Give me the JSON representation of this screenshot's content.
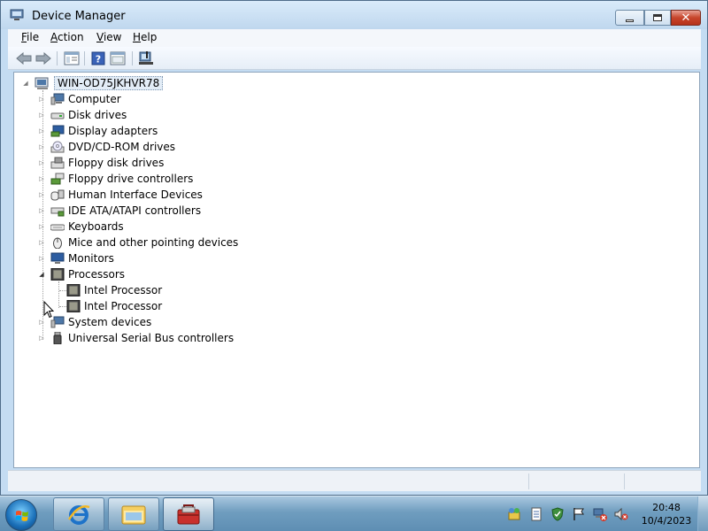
{
  "window": {
    "title": "Device Manager",
    "title_icon": "device-manager-icon"
  },
  "menu": {
    "items": [
      {
        "label": "File",
        "underline": "F",
        "rest": "ile"
      },
      {
        "label": "Action",
        "underline": "A",
        "rest": "ction"
      },
      {
        "label": "View",
        "underline": "V",
        "rest": "iew"
      },
      {
        "label": "Help",
        "underline": "H",
        "rest": "elp"
      }
    ]
  },
  "toolbar": {
    "buttons": [
      "back-arrow-icon",
      "forward-arrow-icon",
      "show-hide-console-tree-icon",
      "help-icon",
      "properties-icon",
      "scan-hardware-icon"
    ]
  },
  "tree": {
    "root": "WIN-OD75JKHVR78",
    "categories": [
      {
        "label": "Computer",
        "icon": "computer-icon",
        "expanded": false
      },
      {
        "label": "Disk drives",
        "icon": "disk-drive-icon",
        "expanded": false
      },
      {
        "label": "Display adapters",
        "icon": "display-adapter-icon",
        "expanded": false
      },
      {
        "label": "DVD/CD-ROM drives",
        "icon": "dvd-drive-icon",
        "expanded": false
      },
      {
        "label": "Floppy disk drives",
        "icon": "floppy-disk-icon",
        "expanded": false
      },
      {
        "label": "Floppy drive controllers",
        "icon": "floppy-controller-icon",
        "expanded": false
      },
      {
        "label": "Human Interface Devices",
        "icon": "hid-icon",
        "expanded": false
      },
      {
        "label": "IDE ATA/ATAPI controllers",
        "icon": "ide-controller-icon",
        "expanded": false
      },
      {
        "label": "Keyboards",
        "icon": "keyboard-icon",
        "expanded": false
      },
      {
        "label": "Mice and other pointing devices",
        "icon": "mouse-icon",
        "expanded": false
      },
      {
        "label": "Monitors",
        "icon": "monitor-icon",
        "expanded": false
      },
      {
        "label": "Processors",
        "icon": "processor-icon",
        "expanded": true,
        "children": [
          "Intel Processor",
          "Intel Processor"
        ]
      },
      {
        "label": "System devices",
        "icon": "system-devices-icon",
        "expanded": false
      },
      {
        "label": "Universal Serial Bus controllers",
        "icon": "usb-icon",
        "expanded": false
      }
    ]
  },
  "taskbar": {
    "apps": [
      "internet-explorer-icon",
      "windows-explorer-icon",
      "device-manager-toolbox-icon"
    ],
    "tray_icons": [
      "network-share-icon",
      "document-icon",
      "shield-check-icon",
      "action-center-flag-icon",
      "network-error-icon",
      "volume-muted-icon"
    ],
    "time": "20:48",
    "date": "10/4/2023"
  },
  "colors": {
    "titlebar": "#c4dcf2",
    "taskbar": "#6f9dbf",
    "close_button": "#c7452c"
  }
}
